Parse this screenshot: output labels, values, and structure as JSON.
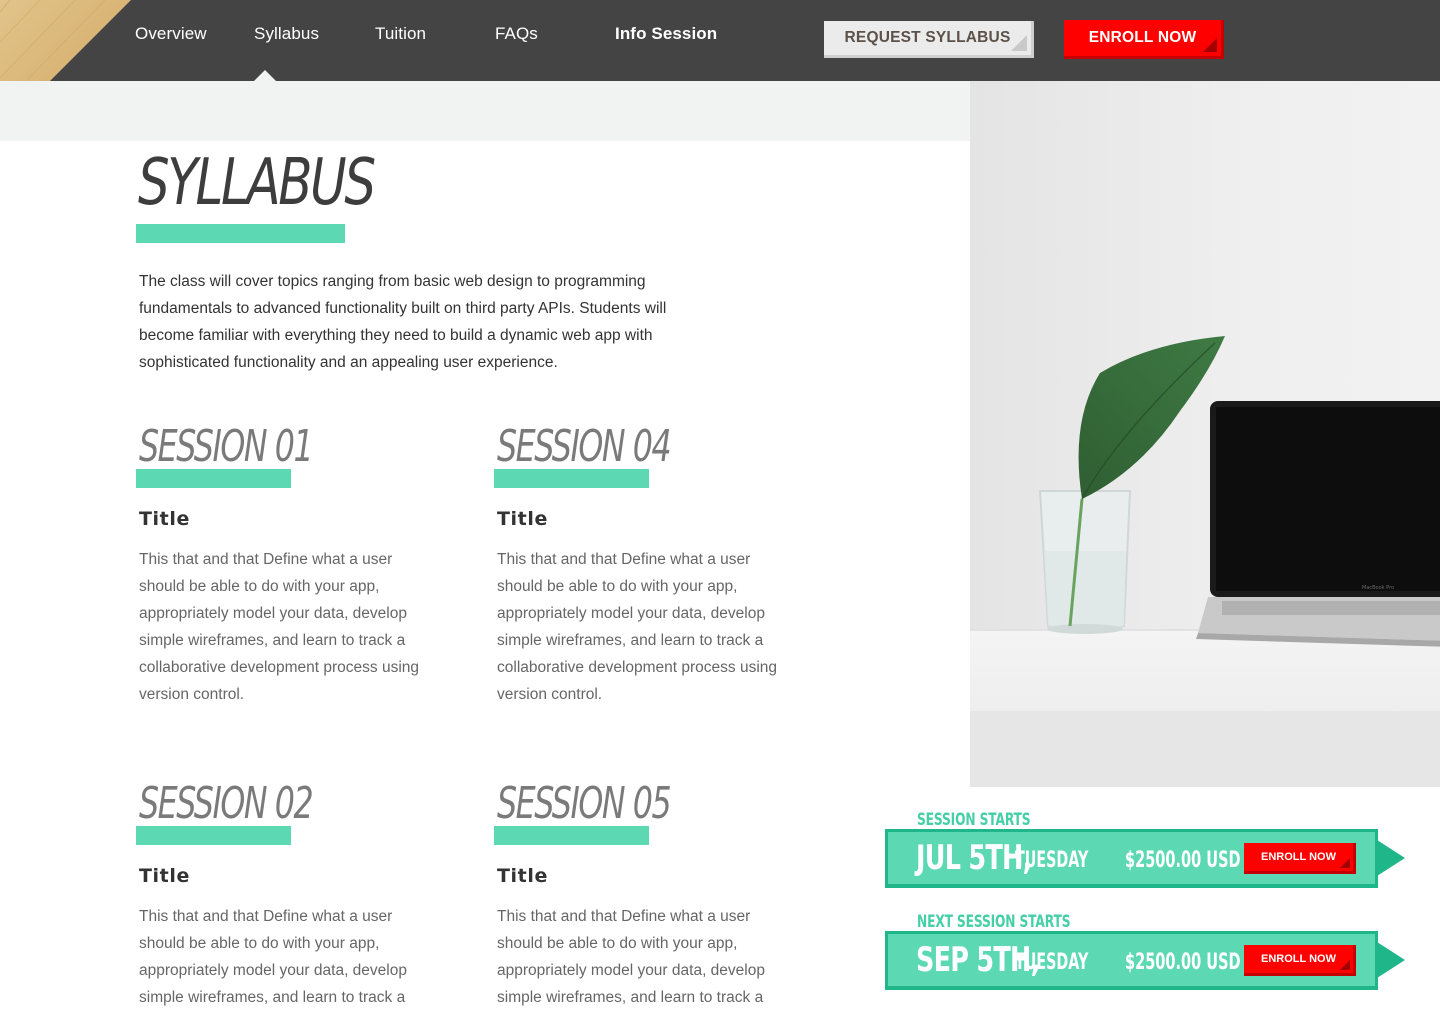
{
  "nav": {
    "links": [
      {
        "label": "Overview"
      },
      {
        "label": "Syllabus"
      },
      {
        "label": "Tuition"
      },
      {
        "label": "FAQs"
      },
      {
        "label": "Info Session"
      }
    ],
    "request_label": "REQUEST SYLLABUS",
    "enroll_label": "ENROLL NOW",
    "active_tab": "Syllabus"
  },
  "colors": {
    "accent": "#5cd9b3",
    "accent_dark": "#1fb68a",
    "cta": "#ff0000",
    "nav_bg": "#444444"
  },
  "page": {
    "title": "SYLLABUS",
    "intro": "The class will cover topics ranging from basic web design to programming fundamentals to advanced functionality built on third party APIs. Students will become familiar with everything they need to build a dynamic web app with sophisticated functionality and an appealing user experience."
  },
  "sessions": [
    {
      "heading": "SESSION 01",
      "title": "Title",
      "body": "This that and that Define what a user should be able to do with your app, appropriately model your data, develop simple wireframes, and learn to track a collaborative development process using version control."
    },
    {
      "heading": "SESSION 04",
      "title": "Title",
      "body": "This that and that Define what a user should be able to do with your app, appropriately model your data, develop simple wireframes, and learn to track a collaborative development process using version control."
    },
    {
      "heading": "SESSION 02",
      "title": "Title",
      "body": "This that and that Define what a user should be able to do with your app, appropriately model your data, develop simple wireframes, and learn to track a"
    },
    {
      "heading": "SESSION 05",
      "title": "Title",
      "body": "This that and that Define what a user should be able to do with your app, appropriately model your data, develop simple wireframes, and learn to track a"
    }
  ],
  "banners": [
    {
      "label": "SESSION STARTS",
      "date": "JUL 5TH,",
      "day": "TUESDAY",
      "price": "$2500.00 USD",
      "button": "ENROLL NOW"
    },
    {
      "label": "NEXT SESSION STARTS",
      "date": "SEP 5TH,",
      "day": "TUESDAY",
      "price": "$2500.00 USD",
      "button": "ENROLL NOW"
    }
  ],
  "photo": {
    "laptop_label": "MacBook Pro"
  }
}
